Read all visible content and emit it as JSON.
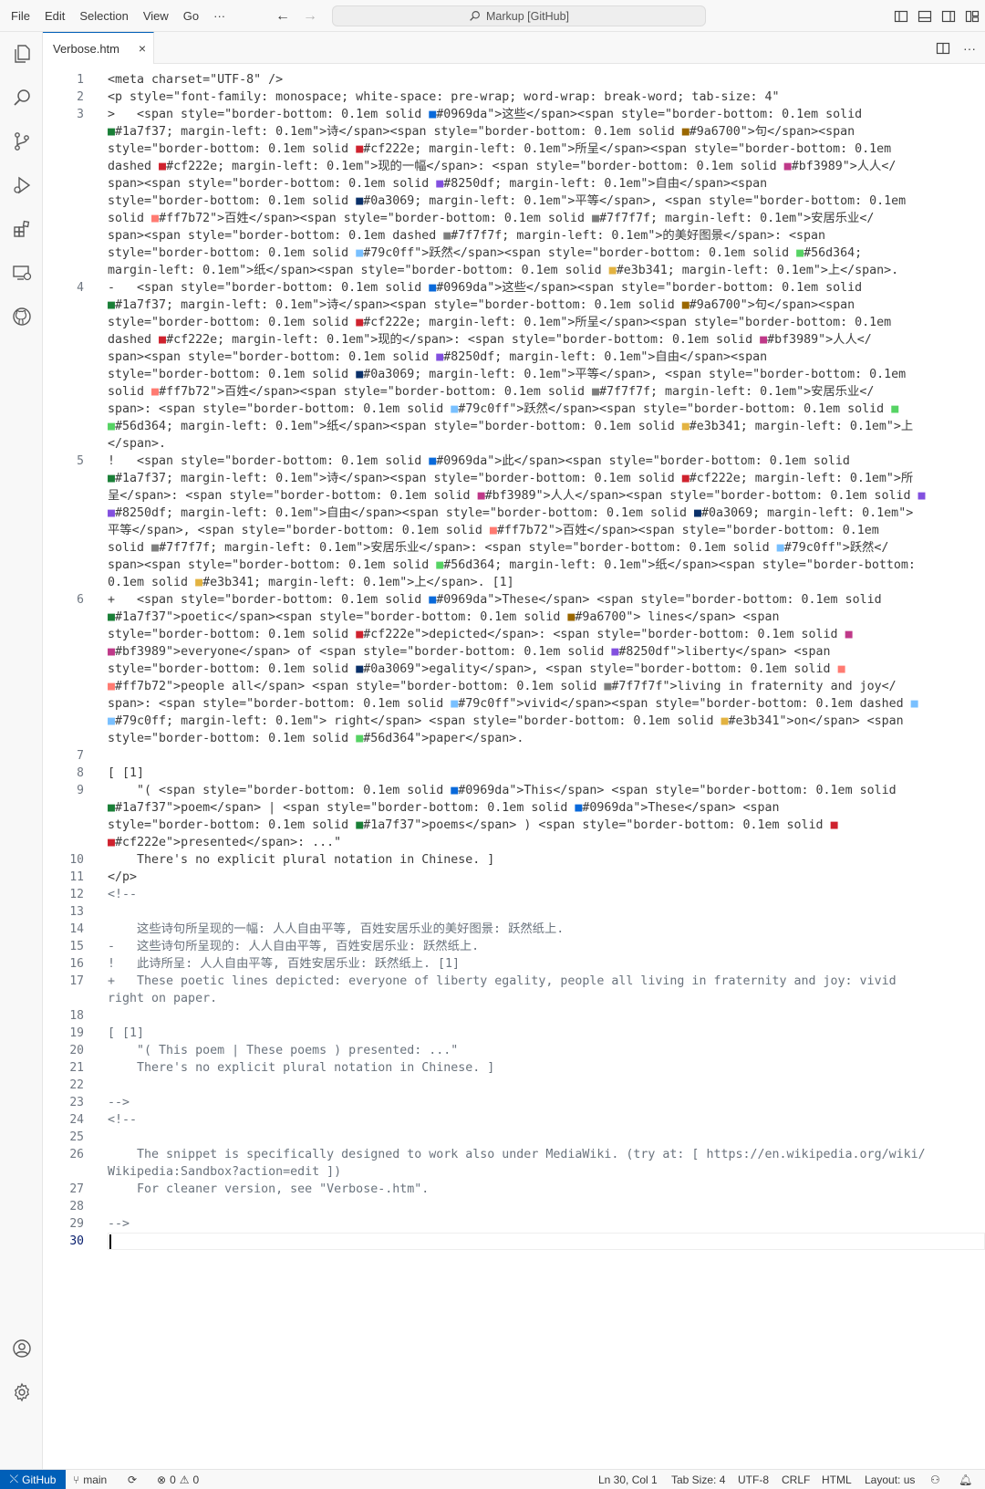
{
  "menu": [
    "File",
    "Edit",
    "Selection",
    "View",
    "Go",
    "···"
  ],
  "command_center": "Markup [GitHub]",
  "tab": {
    "label": "Verbose.htm",
    "close": "×"
  },
  "editor": {
    "lines": [
      {
        "num": "1",
        "text": "<meta charset=\"UTF-8\" />"
      },
      {
        "num": "2",
        "text": "<p style=\"font-family: monospace; white-space: pre-wrap; word-wrap: break-word; tab-size: 4\""
      },
      {
        "num": "3",
        "text": ">   <span style=\"border-bottom: 0.1em solid ■#0969da\">这些</span><span style=\"border-bottom: 0.1em solid\n■#1a7f37; margin-left: 0.1em\">诗</span><span style=\"border-bottom: 0.1em solid ■#9a6700\">句</span><span\nstyle=\"border-bottom: 0.1em solid ■#cf222e; margin-left: 0.1em\">所呈</span><span style=\"border-bottom: 0.1em\ndashed ■#cf222e; margin-left: 0.1em\">现的一幅</span>: <span style=\"border-bottom: 0.1em solid ■#bf3989\">人人</\nspan><span style=\"border-bottom: 0.1em solid ■#8250df; margin-left: 0.1em\">自由</span><span\nstyle=\"border-bottom: 0.1em solid ■#0a3069; margin-left: 0.1em\">平等</span>, <span style=\"border-bottom: 0.1em\nsolid ■#ff7b72\">百姓</span><span style=\"border-bottom: 0.1em solid ■#7f7f7f; margin-left: 0.1em\">安居乐业</\nspan><span style=\"border-bottom: 0.1em dashed ■#7f7f7f; margin-left: 0.1em\">的美好图景</span>: <span\nstyle=\"border-bottom: 0.1em solid ■#79c0ff\">跃然</span><span style=\"border-bottom: 0.1em solid ■#56d364;\nmargin-left: 0.1em\">纸</span><span style=\"border-bottom: 0.1em solid ■#e3b341; margin-left: 0.1em\">上</span>."
      },
      {
        "num": "4",
        "text": "-   <span style=\"border-bottom: 0.1em solid ■#0969da\">这些</span><span style=\"border-bottom: 0.1em solid\n■#1a7f37; margin-left: 0.1em\">诗</span><span style=\"border-bottom: 0.1em solid ■#9a6700\">句</span><span\nstyle=\"border-bottom: 0.1em solid ■#cf222e; margin-left: 0.1em\">所呈</span><span style=\"border-bottom: 0.1em\ndashed ■#cf222e; margin-left: 0.1em\">现的</span>: <span style=\"border-bottom: 0.1em solid ■#bf3989\">人人</\nspan><span style=\"border-bottom: 0.1em solid ■#8250df; margin-left: 0.1em\">自由</span><span\nstyle=\"border-bottom: 0.1em solid ■#0a3069; margin-left: 0.1em\">平等</span>, <span style=\"border-bottom: 0.1em\nsolid ■#ff7b72\">百姓</span><span style=\"border-bottom: 0.1em solid ■#7f7f7f; margin-left: 0.1em\">安居乐业</\nspan>: <span style=\"border-bottom: 0.1em solid ■#79c0ff\">跃然</span><span style=\"border-bottom: 0.1em solid ■\n■#56d364; margin-left: 0.1em\">纸</span><span style=\"border-bottom: 0.1em solid ■#e3b341; margin-left: 0.1em\">上\n</span>."
      },
      {
        "num": "5",
        "text": "!   <span style=\"border-bottom: 0.1em solid ■#0969da\">此</span><span style=\"border-bottom: 0.1em solid\n■#1a7f37; margin-left: 0.1em\">诗</span><span style=\"border-bottom: 0.1em solid ■#cf222e; margin-left: 0.1em\">所\n呈</span>: <span style=\"border-bottom: 0.1em solid ■#bf3989\">人人</span><span style=\"border-bottom: 0.1em solid ■\n■#8250df; margin-left: 0.1em\">自由</span><span style=\"border-bottom: 0.1em solid ■#0a3069; margin-left: 0.1em\">\n平等</span>, <span style=\"border-bottom: 0.1em solid ■#ff7b72\">百姓</span><span style=\"border-bottom: 0.1em\nsolid ■#7f7f7f; margin-left: 0.1em\">安居乐业</span>: <span style=\"border-bottom: 0.1em solid ■#79c0ff\">跃然</\nspan><span style=\"border-bottom: 0.1em solid ■#56d364; margin-left: 0.1em\">纸</span><span style=\"border-bottom:\n0.1em solid ■#e3b341; margin-left: 0.1em\">上</span>. [1]"
      },
      {
        "num": "6",
        "text": "+   <span style=\"border-bottom: 0.1em solid ■#0969da\">These</span> <span style=\"border-bottom: 0.1em solid\n■#1a7f37\">poetic</span><span style=\"border-bottom: 0.1em solid ■#9a6700\"> lines</span> <span\nstyle=\"border-bottom: 0.1em solid ■#cf222e\">depicted</span>: <span style=\"border-bottom: 0.1em solid ■\n■#bf3989\">everyone</span> of <span style=\"border-bottom: 0.1em solid ■#8250df\">liberty</span> <span\nstyle=\"border-bottom: 0.1em solid ■#0a3069\">egality</span>, <span style=\"border-bottom: 0.1em solid ■\n■#ff7b72\">people all</span> <span style=\"border-bottom: 0.1em solid ■#7f7f7f\">living in fraternity and joy</\nspan>: <span style=\"border-bottom: 0.1em solid ■#79c0ff\">vivid</span><span style=\"border-bottom: 0.1em dashed ■\n■#79c0ff; margin-left: 0.1em\"> right</span> <span style=\"border-bottom: 0.1em solid ■#e3b341\">on</span> <span\nstyle=\"border-bottom: 0.1em solid ■#56d364\">paper</span>."
      },
      {
        "num": "7",
        "text": ""
      },
      {
        "num": "8",
        "text": "[ [1]"
      },
      {
        "num": "9",
        "text": "    \"( <span style=\"border-bottom: 0.1em solid ■#0969da\">This</span> <span style=\"border-bottom: 0.1em solid\n■#1a7f37\">poem</span> | <span style=\"border-bottom: 0.1em solid ■#0969da\">These</span> <span\nstyle=\"border-bottom: 0.1em solid ■#1a7f37\">poems</span> ) <span style=\"border-bottom: 0.1em solid ■\n■#cf222e\">presented</span>: ...\""
      },
      {
        "num": "10",
        "text": "    There's no explicit plural notation in Chinese. ]"
      },
      {
        "num": "11",
        "text": "</p>"
      },
      {
        "num": "12",
        "text": "<!--",
        "comment": true
      },
      {
        "num": "13",
        "text": "",
        "comment": true
      },
      {
        "num": "14",
        "text": "    这些诗句所呈现的一幅: 人人自由平等, 百姓安居乐业的美好图景: 跃然纸上.",
        "comment": true
      },
      {
        "num": "15",
        "text": "-   这些诗句所呈现的: 人人自由平等, 百姓安居乐业: 跃然纸上.",
        "comment": true
      },
      {
        "num": "16",
        "text": "!   此诗所呈: 人人自由平等, 百姓安居乐业: 跃然纸上. [1]",
        "comment": true
      },
      {
        "num": "17",
        "text": "+   These poetic lines depicted: everyone of liberty egality, people all living in fraternity and joy: vivid\nright on paper.",
        "comment": true
      },
      {
        "num": "18",
        "text": "",
        "comment": true
      },
      {
        "num": "19",
        "text": "[ [1]",
        "comment": true
      },
      {
        "num": "20",
        "text": "    \"( This poem | These poems ) presented: ...\"",
        "comment": true
      },
      {
        "num": "21",
        "text": "    There's no explicit plural notation in Chinese. ]",
        "comment": true
      },
      {
        "num": "22",
        "text": "",
        "comment": true
      },
      {
        "num": "23",
        "text": "-->",
        "comment": true
      },
      {
        "num": "24",
        "text": "<!--",
        "comment": true
      },
      {
        "num": "25",
        "text": "",
        "comment": true
      },
      {
        "num": "26",
        "text": "    The snippet is specifically designed to work also under MediaWiki. (try at: [ https://en.wikipedia.org/wiki/\nWikipedia:Sandbox?action=edit ])",
        "comment": true
      },
      {
        "num": "27",
        "text": "    For cleaner version, see \"Verbose-.htm\".",
        "comment": true
      },
      {
        "num": "28",
        "text": "",
        "comment": true
      },
      {
        "num": "29",
        "text": "-->",
        "comment": true
      },
      {
        "num": "30",
        "text": "",
        "active": true
      }
    ]
  },
  "statusbar": {
    "remote": "GitHub",
    "branch": "main",
    "errors": "0",
    "warnings": "0",
    "position": "Ln 30, Col 1",
    "tab_size": "Tab Size: 4",
    "encoding": "UTF-8",
    "eol": "CRLF",
    "language": "HTML",
    "layout": "Layout: us"
  },
  "colors": {
    "accent": "#005fb8",
    "line_number": "#6e7681",
    "comment": "#6a737d"
  }
}
